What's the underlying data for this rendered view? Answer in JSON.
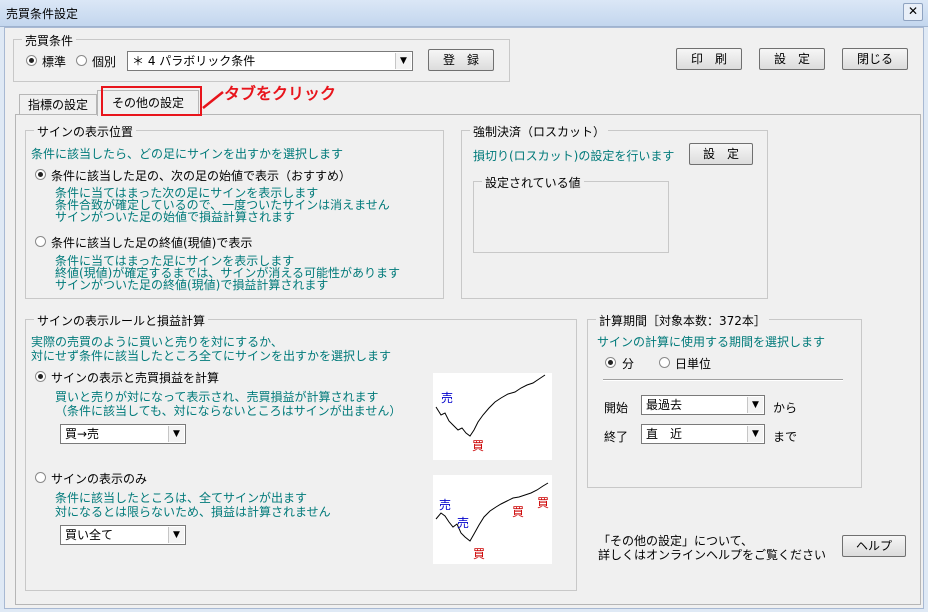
{
  "window": {
    "title": "売買条件設定",
    "close_glyph": "✕"
  },
  "buy_sell_condition": {
    "legend": "売買条件",
    "radio_standard": "標準",
    "radio_individual": "個別",
    "selected_condition": "＊ 4 パラボリック条件",
    "register_button": "登　録"
  },
  "top_buttons": {
    "print": "印　刷",
    "settings": "設　定",
    "close": "閉じる"
  },
  "tabs": [
    {
      "label": "指標の設定"
    },
    {
      "label": "その他の設定"
    }
  ],
  "annotation": {
    "text": "タブをクリック",
    "color": "#e8141b"
  },
  "sign_position": {
    "legend": "サインの表示位置",
    "description": "条件に該当したら、どの足にサインを出すかを選択します",
    "option1": "条件に該当した足の、次の足の始値で表示（おすすめ）",
    "option1_desc": [
      "条件に当てはまった次の足にサインを表示します",
      "条件合致が確定しているので、一度ついたサインは消えません",
      "サインがついた足の始値で損益計算されます"
    ],
    "option2": "条件に該当した足の終値(現値)で表示",
    "option2_desc": [
      "条件に当てはまった足にサインを表示します",
      "終値(現値)が確定するまでは、サインが消える可能性があります",
      "サインがついた足の終値(現値)で損益計算されます"
    ]
  },
  "forced_settlement": {
    "legend": "強制決済（ロスカット）",
    "description": "損切り(ロスカット)の設定を行います",
    "settings_button": "設　定",
    "current_values_legend": "設定されている値"
  },
  "sign_rule": {
    "legend": "サインの表示ルールと損益計算",
    "description": [
      "実際の売買のように買いと売りを対にするか、",
      "対にせず条件に該当したところ全てにサインを出すかを選択します"
    ],
    "option1": "サインの表示と売買損益を計算",
    "option1_desc": [
      "買いと売りが対になって表示され、売買損益が計算されます",
      "（条件に該当しても、対にならないところはサインが出ません）"
    ],
    "option1_combo": "買→売",
    "option2": "サインの表示のみ",
    "option2_desc": [
      "条件に該当したところは、全てサインが出ます",
      "対になるとは限らないため、損益は計算されません"
    ],
    "option2_combo": "買い全て",
    "chart1_labels": {
      "sell": "売",
      "buy": "買"
    },
    "chart2_labels": {
      "sell1": "売",
      "sell2": "売",
      "buy1": "買",
      "buy2": "買",
      "buy3": "買"
    }
  },
  "calc_period": {
    "legend": "計算期間［対象本数：372本］",
    "description": "サインの計算に使用する期間を選択します",
    "radio_minute": "分",
    "radio_day": "日単位",
    "start_label": "開始",
    "start_value": "最過去",
    "from_suffix": "から",
    "end_label": "終了",
    "end_value": "直　近",
    "to_suffix": "まで"
  },
  "help": {
    "text_line1": "「その他の設定」について、",
    "text_line2": "詳しくはオンラインヘルプをご覧ください",
    "button": "ヘルプ"
  },
  "colors": {
    "accent_teal": "#007a7a",
    "buy_label": "#cc0000",
    "sell_label": "#0000cc"
  }
}
